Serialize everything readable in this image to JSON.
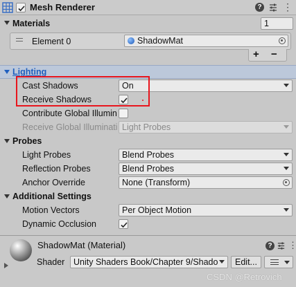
{
  "component": {
    "title": "Mesh Renderer",
    "enabled": true,
    "icons": [
      "mesh-renderer-icon",
      "help-icon",
      "preset-icon",
      "more-icon"
    ]
  },
  "materials": {
    "header": "Materials",
    "size": "1",
    "element_label": "Element 0",
    "element_value": "ShadowMat",
    "add_label": "+",
    "remove_label": "−"
  },
  "lighting": {
    "header": "Lighting",
    "cast_shadows_label": "Cast Shadows",
    "cast_shadows_value": "On",
    "receive_shadows_label": "Receive Shadows",
    "receive_shadows_checked": true,
    "contribute_gi_label": "Contribute Global Illumin",
    "receive_gi_label": "Receive Global Illuminati",
    "receive_gi_value": "Light Probes"
  },
  "probes": {
    "header": "Probes",
    "light_probes_label": "Light Probes",
    "light_probes_value": "Blend Probes",
    "reflection_probes_label": "Reflection Probes",
    "reflection_probes_value": "Blend Probes",
    "anchor_override_label": "Anchor Override",
    "anchor_override_value": "None (Transform)"
  },
  "additional": {
    "header": "Additional Settings",
    "motion_vectors_label": "Motion Vectors",
    "motion_vectors_value": "Per Object Motion",
    "dynamic_occlusion_label": "Dynamic Occlusion",
    "dynamic_occlusion_checked": true
  },
  "material_preview": {
    "title": "ShadowMat (Material)",
    "shader_label": "Shader",
    "shader_value": "Unity Shaders Book/Chapter 9/Shado",
    "edit_label": "Edit..."
  },
  "watermark": "CSDN @Retrovich",
  "colors": {
    "highlight_box": "#e8141c",
    "lighting_header": "#1f5fbf"
  }
}
